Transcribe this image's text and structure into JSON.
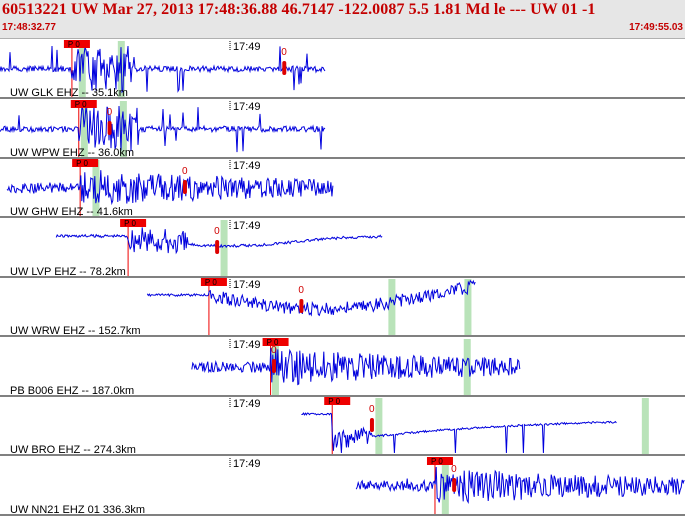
{
  "header": {
    "title": "60513221 UW Mar 27, 2013 17:48:36.88    46.7147 -122.0087  5.5 1.81 Md le --- UW 01   -1",
    "start_time": "17:48:32.77",
    "end_time": "17:49:55.03"
  },
  "colors": {
    "header_text": "#c40000",
    "trace": "#0000dd",
    "pick_box": "#ee0000",
    "window_band": "#b9e3b9",
    "separator": "#000000"
  },
  "minute_label": "17:49",
  "pick_label": "P 0",
  "o_label": "0",
  "traces": [
    {
      "label": "UW GLK EHZ -- 35.1km",
      "start": 0.0,
      "end": 0.475,
      "pick": 0.105,
      "amp": 0.9,
      "style": "spiky",
      "windows": [
        0.115,
        0.172
      ],
      "o_mark": 0.415,
      "seed": 11
    },
    {
      "label": "UW WPW EHZ -- 36.0km",
      "start": 0.0,
      "end": 0.475,
      "pick": 0.115,
      "amp": 0.9,
      "style": "spiky",
      "windows": [
        0.118,
        0.175
      ],
      "o_mark": 0.16,
      "seed": 23
    },
    {
      "label": "UW GHW EHZ -- 41.6km",
      "start": 0.01,
      "end": 0.487,
      "pick": 0.117,
      "amp": 0.6,
      "style": "noise",
      "windows": [
        0.135
      ],
      "o_mark": 0.27,
      "seed": 37
    },
    {
      "label": "UW LVP EHZ -- 78.2km",
      "start": 0.082,
      "end": 0.558,
      "pick": 0.187,
      "amp": 0.5,
      "style": "drift",
      "windows": [
        0.322
      ],
      "o_mark": 0.317,
      "seed": 41
    },
    {
      "label": "UW WRW EHZ -- 152.7km",
      "start": 0.215,
      "end": 0.695,
      "pick": 0.305,
      "amp": 0.55,
      "style": "noise-drift",
      "windows": [
        0.567,
        0.678
      ],
      "o_mark": 0.44,
      "seed": 53
    },
    {
      "label": "PB B006 EHZ -- 187.0km",
      "start": 0.28,
      "end": 0.76,
      "pick": 0.395,
      "amp": 0.6,
      "style": "noise",
      "windows": [
        0.397,
        0.677
      ],
      "o_mark": 0.4,
      "seed": 67
    },
    {
      "label": "UW BRO EHZ -- 274.3km",
      "start": 0.44,
      "end": 0.9,
      "pick": 0.485,
      "amp": 0.55,
      "style": "step",
      "windows": [
        0.548,
        0.937
      ],
      "o_mark": 0.543,
      "seed": 79
    },
    {
      "label": "UW NN21 EHZ 01 336.3km",
      "start": 0.52,
      "end": 1.0,
      "pick": 0.635,
      "amp": 0.6,
      "style": "noise",
      "windows": [
        0.645
      ],
      "o_mark": 0.663,
      "seed": 97
    }
  ]
}
